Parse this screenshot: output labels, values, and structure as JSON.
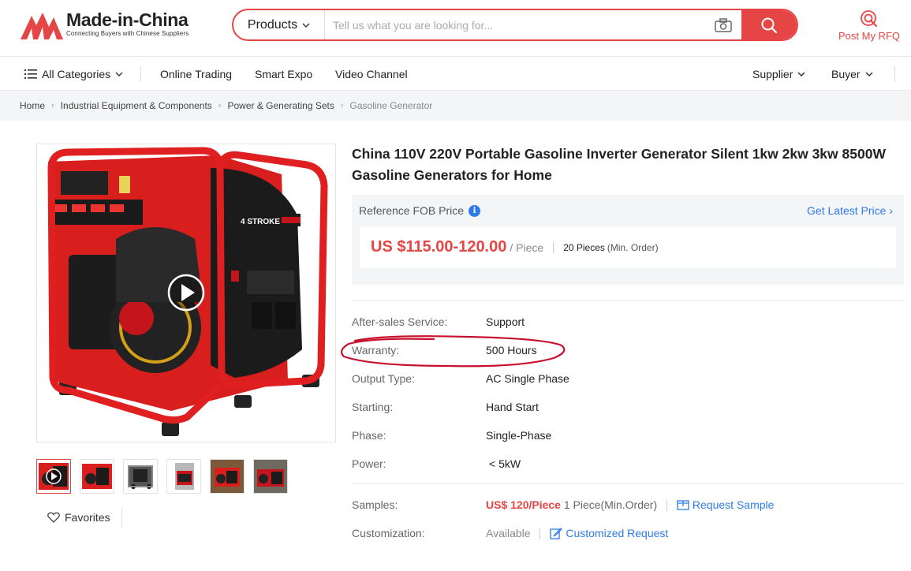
{
  "header": {
    "logo_title": "Made-in-China",
    "logo_subtitle": "Connecting Buyers with Chinese Suppliers",
    "search_category": "Products",
    "search_placeholder": "Tell us what you are looking for...",
    "rfq_label": "Post My RFQ"
  },
  "nav": {
    "all_categories": "All Categories",
    "items": [
      "Online Trading",
      "Smart Expo",
      "Video Channel"
    ],
    "supplier": "Supplier",
    "buyer": "Buyer"
  },
  "breadcrumb": [
    "Home",
    "Industrial Equipment & Components",
    "Power & Generating Sets",
    "Gasoline Generator"
  ],
  "gallery": {
    "engine_label": "4 STROKE",
    "favorites_label": "Favorites",
    "thumb_count": 6
  },
  "product": {
    "title": "China 110V 220V Portable Gasoline Inverter Generator Silent 1kw 2kw 3kw 8500W Gasoline Generators for Home",
    "price_label": "Reference FOB Price",
    "get_latest_price": "Get Latest Price",
    "price": "US $115.00-120.00",
    "price_unit": "/ Piece",
    "moq_value": "20 Pieces",
    "moq_note": "(Min. Order)",
    "attributes": [
      {
        "key": "After-sales Service:",
        "value": "Support"
      },
      {
        "key": "Warranty:",
        "value": "500 Hours"
      },
      {
        "key": "Output Type:",
        "value": "AC Single Phase"
      },
      {
        "key": "Starting:",
        "value": "Hand Start"
      },
      {
        "key": "Phase:",
        "value": "Single-Phase"
      },
      {
        "key": "Power:",
        "value": "< 5kW"
      }
    ],
    "samples": {
      "key": "Samples:",
      "price": "US$ 120/Piece",
      "note": "1 Piece(Min.Order)",
      "link": "Request Sample"
    },
    "customization": {
      "key": "Customization:",
      "status": "Available",
      "link": "Customized Request"
    }
  },
  "colors": {
    "brand_red": "#e64545",
    "link_blue": "#2f7be5",
    "annotation_red": "#c8102e"
  }
}
